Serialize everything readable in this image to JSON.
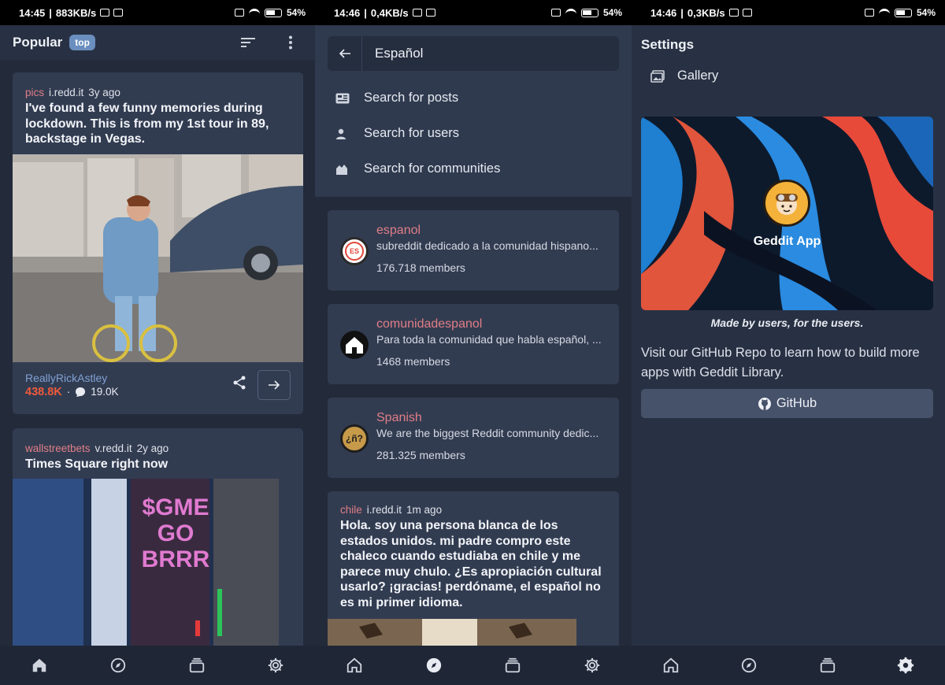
{
  "screen1": {
    "status": {
      "time": "14:45",
      "speed": "883KB/s",
      "battery": "54%"
    },
    "appbar": {
      "title": "Popular",
      "chip": "top"
    },
    "posts": [
      {
        "sub": "pics",
        "domain": "i.redd.it",
        "age": "3y ago",
        "title": "I've found a few funny memories during lockdown. This is from my 1st tour in 89, backstage in Vegas.",
        "author": "ReallyRickAstley",
        "score": "438.8K",
        "comments": "19.0K"
      },
      {
        "sub": "wallstreetbets",
        "domain": "v.redd.it",
        "age": "2y ago",
        "title": "Times Square right now",
        "image_text": [
          "$GME",
          "GO",
          "BRRR"
        ]
      }
    ]
  },
  "screen2": {
    "status": {
      "time": "14:46",
      "speed": "0,4KB/s",
      "battery": "54%"
    },
    "search": {
      "value": "Español"
    },
    "options": [
      "Search for posts",
      "Search for users",
      "Search for communities"
    ],
    "communities": [
      {
        "name": "espanol",
        "desc": "subreddit dedicado a la comunidad hispano...",
        "members": "176.718 members",
        "icon": "ES"
      },
      {
        "name": "comunidadespanol",
        "desc": "Para toda la comunidad que habla español, ...",
        "members": "1468 members",
        "icon": ""
      },
      {
        "name": "Spanish",
        "desc": "We are the biggest Reddit community dedic...",
        "members": "281.325 members",
        "icon": "¿ñ?"
      }
    ],
    "post": {
      "sub": "chile",
      "domain": "i.redd.it",
      "age": "1m ago",
      "title": "Hola. soy una persona blanca de los estados unidos. mi padre compro este chaleco cuando estudiaba en chile y me parece muy chulo. ¿Es apropiación cultural usarlo? ¡gracias! perdóname, el español no es mi primer idioma."
    }
  },
  "screen3": {
    "status": {
      "time": "14:46",
      "speed": "0,3KB/s",
      "battery": "54%"
    },
    "title": "Settings",
    "gallery": "Gallery",
    "banner_label": "Geddit App",
    "tagline": "Made by users, for the users.",
    "visit": "Visit our GitHub Repo to learn how to build more apps with Geddit Library.",
    "github_button": "GitHub"
  },
  "colors": {
    "background": "#232a3a",
    "card": "#323c51",
    "accent_subreddit": "#e07e86",
    "score": "#ef5a3c",
    "author": "#7fa1d3"
  }
}
